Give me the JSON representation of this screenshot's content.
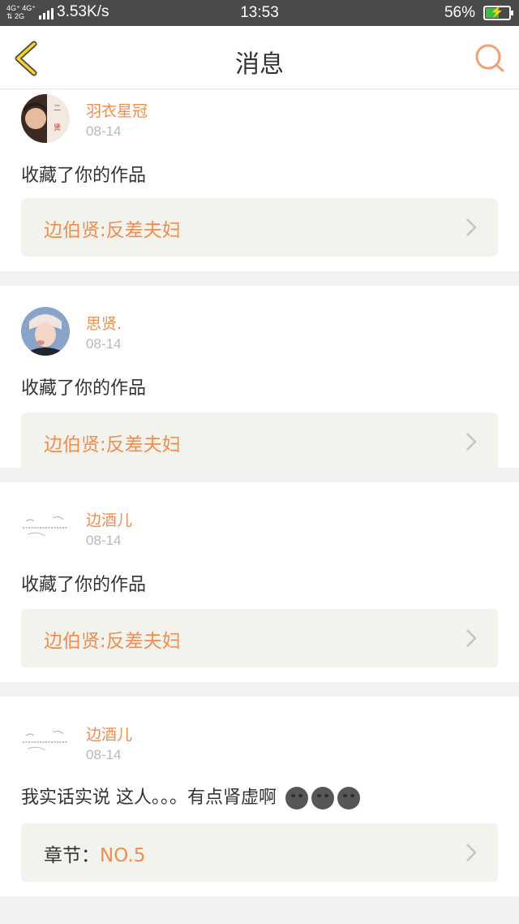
{
  "status_bar": {
    "net_top": "4G⁺ 4G⁺",
    "net_bottom": "⇅ 2G",
    "speed": "3.53K/s",
    "time": "13:53",
    "battery": "56%",
    "battery_level": 0.56,
    "battery_color": "#35c13e"
  },
  "header": {
    "title": "消息",
    "accent": "#f3a070"
  },
  "messages": [
    {
      "user": "羽衣星冠",
      "date": "08-14",
      "text": "收藏了你的作品",
      "link_label": "",
      "link_value": "边伯贤:反差夫妇",
      "avatar": "photo"
    },
    {
      "user": "思贤.",
      "date": "08-14",
      "text": "收藏了你的作品",
      "link_label": "",
      "link_value": "边伯贤:反差夫妇",
      "avatar": "photo"
    },
    {
      "user": "边酒儿",
      "date": "08-14",
      "text": "收藏了你的作品",
      "link_label": "",
      "link_value": "边伯贤:反差夫妇",
      "avatar": "handwriting"
    },
    {
      "user": "边酒儿",
      "date": "08-14",
      "text": "我实话实说 这人。。。有点肾虚啊",
      "link_label": "章节：",
      "link_value": "NO.5",
      "avatar": "handwriting",
      "emoji": [
        "new-moon-face-emoji",
        "new-moon-face-emoji",
        "new-moon-face-emoji"
      ]
    }
  ],
  "colors": {
    "username": "#f08d4f",
    "date": "#b9b9b9",
    "link_bg": "#f3f3ee"
  }
}
